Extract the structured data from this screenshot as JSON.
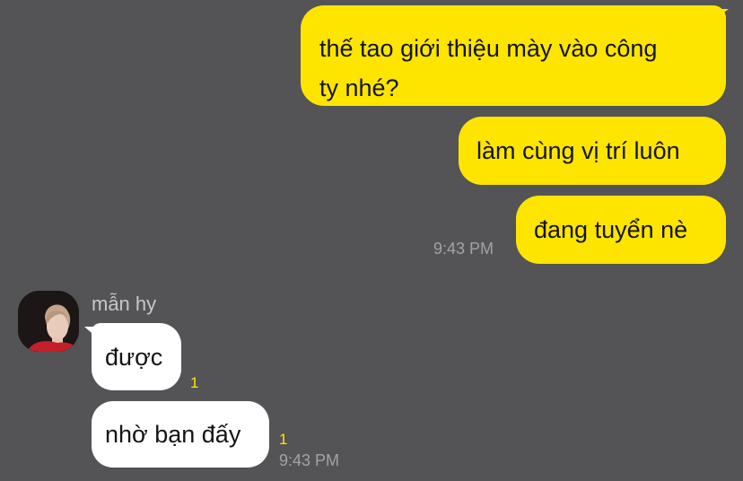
{
  "messages": {
    "outgoing": [
      {
        "lines": [
          "thế tao giới thiệu mày vào công",
          "ty nhé?"
        ]
      },
      {
        "text": "làm cùng vị trí luôn"
      },
      {
        "text": "đang tuyển nè"
      }
    ],
    "outgoing_time": "9:43 PM",
    "incoming": {
      "sender": "mẫn hy",
      "items": [
        {
          "text": "được",
          "unread": "1"
        },
        {
          "text": "nhờ bạn đấy",
          "unread": "1"
        }
      ],
      "time": "9:43 PM"
    }
  },
  "colors": {
    "background": "#545355",
    "outgoing_bubble": "#fee500",
    "incoming_bubble": "#ffffff",
    "unread_count": "#fee500"
  }
}
